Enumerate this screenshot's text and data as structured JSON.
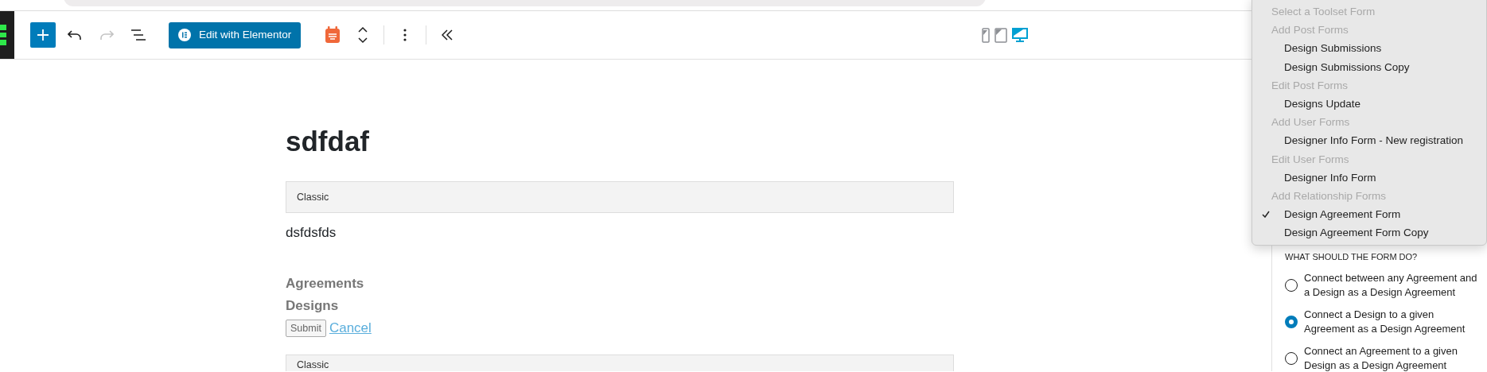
{
  "toolbar": {
    "edit_button": "Edit with Elementor",
    "redo_disabled": true,
    "devices": [
      {
        "kind": "mobile",
        "selected": false
      },
      {
        "kind": "tablet",
        "selected": false
      },
      {
        "kind": "desktop",
        "selected": true
      }
    ]
  },
  "content": {
    "title": "sdfdaf",
    "blocks": [
      {
        "kind": "classic",
        "label": "Classic"
      },
      {
        "kind": "paragraph",
        "text": "dsfdsfds"
      },
      {
        "kind": "form",
        "fields": [
          "Agreements",
          "Designs"
        ],
        "submit": "Submit",
        "cancel": "Cancel"
      },
      {
        "kind": "classic",
        "label": "Classic"
      }
    ]
  },
  "form_menu": {
    "items": [
      {
        "kind": "header",
        "label": "Select a Toolset Form"
      },
      {
        "kind": "header",
        "label": "Add Post Forms"
      },
      {
        "kind": "option",
        "label": "Design Submissions",
        "selected": false
      },
      {
        "kind": "option",
        "label": "Design Submissions Copy",
        "selected": false
      },
      {
        "kind": "header",
        "label": "Edit Post Forms"
      },
      {
        "kind": "option",
        "label": "Designs Update",
        "selected": false
      },
      {
        "kind": "header",
        "label": "Add User Forms"
      },
      {
        "kind": "option",
        "label": "Designer Info Form - New registration",
        "selected": false
      },
      {
        "kind": "header",
        "label": "Edit User Forms"
      },
      {
        "kind": "option",
        "label": "Designer Info Form",
        "selected": false
      },
      {
        "kind": "header",
        "label": "Add Relationship Forms"
      },
      {
        "kind": "option",
        "label": "Design Agreement Form",
        "selected": true
      },
      {
        "kind": "option",
        "label": "Design Agreement Form Copy",
        "selected": false
      }
    ]
  },
  "sidebar": {
    "heading": "WHAT SHOULD THE FORM DO?",
    "options": [
      {
        "label": "Connect between any Agreement and a Design as a Design Agreement",
        "selected": false
      },
      {
        "label": "Connect a Design to a given Agreement as a Design Agreement",
        "selected": true
      },
      {
        "label": "Connect an Agreement to a given Design as a Design Agreement",
        "selected": false
      }
    ]
  }
}
